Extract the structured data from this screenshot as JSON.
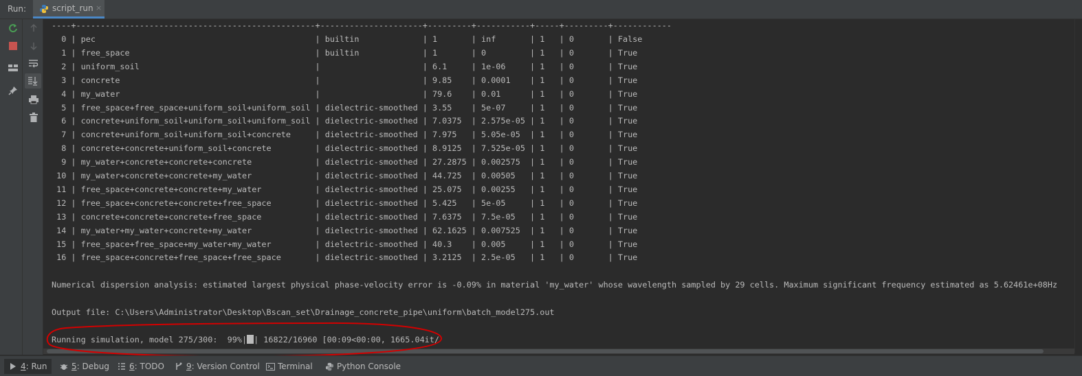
{
  "header": {
    "run_label": "Run:",
    "tab_label": "script_run",
    "tab_close": "×"
  },
  "console": {
    "separator": "----+-------------------------------------------------+---------------------+---------+-----------+-----+---------+------------",
    "rows": [
      {
        "idx": "0",
        "name": "pec",
        "type": "builtin",
        "er": "1",
        "sig": "inf",
        "mr": "1",
        "sm": "0",
        "av": "False"
      },
      {
        "idx": "1",
        "name": "free_space",
        "type": "builtin",
        "er": "1",
        "sig": "0",
        "mr": "1",
        "sm": "0",
        "av": "True"
      },
      {
        "idx": "2",
        "name": "uniform_soil",
        "type": "",
        "er": "6.1",
        "sig": "1e-06",
        "mr": "1",
        "sm": "0",
        "av": "True"
      },
      {
        "idx": "3",
        "name": "concrete",
        "type": "",
        "er": "9.85",
        "sig": "0.0001",
        "mr": "1",
        "sm": "0",
        "av": "True"
      },
      {
        "idx": "4",
        "name": "my_water",
        "type": "",
        "er": "79.6",
        "sig": "0.01",
        "mr": "1",
        "sm": "0",
        "av": "True"
      },
      {
        "idx": "5",
        "name": "free_space+free_space+uniform_soil+uniform_soil",
        "type": "dielectric-smoothed",
        "er": "3.55",
        "sig": "5e-07",
        "mr": "1",
        "sm": "0",
        "av": "True"
      },
      {
        "idx": "6",
        "name": "concrete+uniform_soil+uniform_soil+uniform_soil",
        "type": "dielectric-smoothed",
        "er": "7.0375",
        "sig": "2.575e-05",
        "mr": "1",
        "sm": "0",
        "av": "True"
      },
      {
        "idx": "7",
        "name": "concrete+uniform_soil+uniform_soil+concrete",
        "type": "dielectric-smoothed",
        "er": "7.975",
        "sig": "5.05e-05",
        "mr": "1",
        "sm": "0",
        "av": "True"
      },
      {
        "idx": "8",
        "name": "concrete+concrete+uniform_soil+concrete",
        "type": "dielectric-smoothed",
        "er": "8.9125",
        "sig": "7.525e-05",
        "mr": "1",
        "sm": "0",
        "av": "True"
      },
      {
        "idx": "9",
        "name": "my_water+concrete+concrete+concrete",
        "type": "dielectric-smoothed",
        "er": "27.2875",
        "sig": "0.002575",
        "mr": "1",
        "sm": "0",
        "av": "True"
      },
      {
        "idx": "10",
        "name": "my_water+concrete+concrete+my_water",
        "type": "dielectric-smoothed",
        "er": "44.725",
        "sig": "0.00505",
        "mr": "1",
        "sm": "0",
        "av": "True"
      },
      {
        "idx": "11",
        "name": "free_space+concrete+concrete+my_water",
        "type": "dielectric-smoothed",
        "er": "25.075",
        "sig": "0.00255",
        "mr": "1",
        "sm": "0",
        "av": "True"
      },
      {
        "idx": "12",
        "name": "free_space+concrete+concrete+free_space",
        "type": "dielectric-smoothed",
        "er": "5.425",
        "sig": "5e-05",
        "mr": "1",
        "sm": "0",
        "av": "True"
      },
      {
        "idx": "13",
        "name": "concrete+concrete+concrete+free_space",
        "type": "dielectric-smoothed",
        "er": "7.6375",
        "sig": "7.5e-05",
        "mr": "1",
        "sm": "0",
        "av": "True"
      },
      {
        "idx": "14",
        "name": "my_water+my_water+concrete+my_water",
        "type": "dielectric-smoothed",
        "er": "62.1625",
        "sig": "0.007525",
        "mr": "1",
        "sm": "0",
        "av": "True"
      },
      {
        "idx": "15",
        "name": "free_space+free_space+my_water+my_water",
        "type": "dielectric-smoothed",
        "er": "40.3",
        "sig": "0.005",
        "mr": "1",
        "sm": "0",
        "av": "True"
      },
      {
        "idx": "16",
        "name": "free_space+concrete+free_space+free_space",
        "type": "dielectric-smoothed",
        "er": "3.2125",
        "sig": "2.5e-05",
        "mr": "1",
        "sm": "0",
        "av": "True"
      }
    ],
    "dispersion_line": "Numerical dispersion analysis: estimated largest physical phase-velocity error is -0.09% in material 'my_water' whose wavelength sampled by 29 cells. Maximum significant frequency estimated as 5.62461e+08Hz",
    "output_line": "Output file: C:\\Users\\Administrator\\Desktop\\Bscan_set\\Drainage_concrete_pipe\\uniform\\batch_model275.out",
    "progress": {
      "prefix": "Running simulation, model 275/300:  99%|",
      "suffix": "| 16822/16960 [00:09<00:00, 1665.04it/",
      "percent": 99
    }
  },
  "toolbar": {
    "icons": [
      "rerun-icon",
      "up-arrow-icon",
      "stop-icon",
      "down-arrow-icon",
      "layout-icon",
      "soft-wrap-icon",
      "scroll-to-end-icon",
      "pin-icon",
      "print-icon",
      "trash-icon"
    ]
  },
  "bottom_tabs": [
    {
      "num": "4",
      "label": ": Run"
    },
    {
      "num": "5",
      "label": ": Debug"
    },
    {
      "num": "6",
      "label": ": TODO"
    },
    {
      "num": "9",
      "label": ": Version Control"
    },
    {
      "num": "",
      "label": "Terminal"
    },
    {
      "num": "",
      "label": "Python Console"
    }
  ],
  "colors": {
    "background": "#2b2b2b",
    "panel": "#3c3f41",
    "text": "#bbbbbb",
    "rerun_green": "#499c54",
    "stop_red": "#c75450",
    "annotation_red": "#d40000",
    "tab_accent": "#4a88c7"
  }
}
